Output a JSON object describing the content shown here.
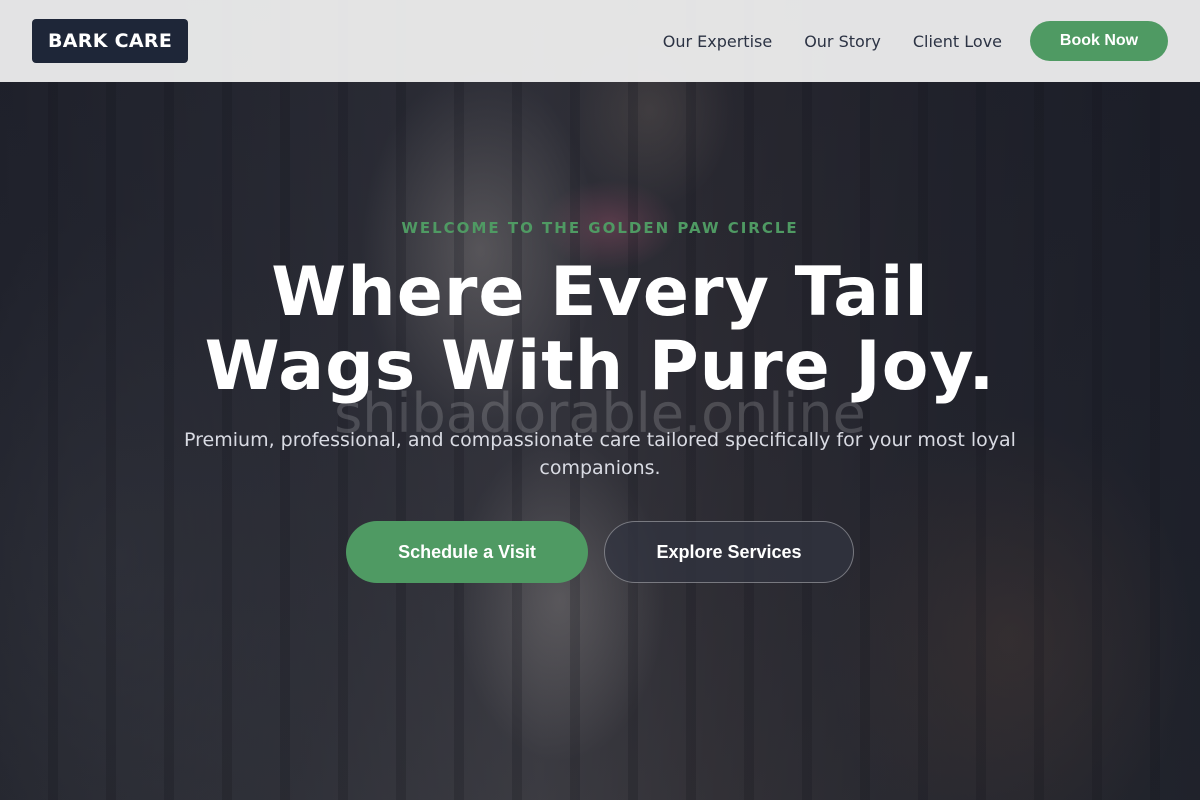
{
  "brand": {
    "logo_text": "BARK CARE"
  },
  "nav": {
    "links": [
      "Our Expertise",
      "Our Story",
      "Client Love"
    ],
    "cta_label": "Book Now"
  },
  "hero": {
    "eyebrow": "WELCOME TO THE GOLDEN PAW CIRCLE",
    "headline_line1": "Where Every Tail",
    "headline_line2": "Wags With Pure Joy.",
    "watermark": "shibadorable.online",
    "subtext": "Premium, professional, and compassionate care tailored specifically for your most loyal companions.",
    "primary_cta": "Schedule a Visit",
    "secondary_cta": "Explore Services"
  },
  "colors": {
    "accent": "#4f9a63",
    "logo_bg": "#1e2638",
    "nav_bg": "#eeeeee",
    "nav_text": "#2c3344"
  }
}
